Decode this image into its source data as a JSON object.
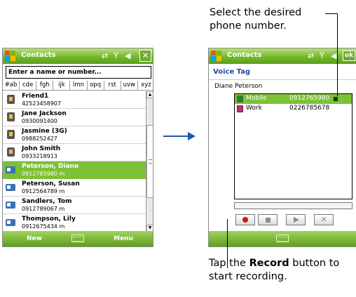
{
  "phone1": {
    "title": "Contacts",
    "status_icons": "⇄ Ÿ◀",
    "close_label": "✕",
    "search_placeholder": "Enter a name or number...",
    "alpha_tabs": [
      "#ab",
      "cde",
      "fgh",
      "ijk",
      "lmn",
      "opq",
      "rst",
      "uvw",
      "xyz"
    ],
    "contacts": [
      {
        "name": "Friend1",
        "number": "42523458907",
        "icon": "sim-card-icon",
        "selected": false
      },
      {
        "name": "Jane Jackson",
        "number": "0930091400",
        "icon": "sim-card-icon",
        "selected": false
      },
      {
        "name": "Jasmine (3G)",
        "number": "0988252427",
        "icon": "sim-card-icon",
        "selected": false
      },
      {
        "name": "John Smith",
        "number": "0933218913",
        "icon": "sim-card-icon",
        "selected": false
      },
      {
        "name": "Peterson, Diane",
        "number": "0912765980   m",
        "icon": "contact-card-icon",
        "selected": true
      },
      {
        "name": "Peterson, Susan",
        "number": "0912564789   m",
        "icon": "contact-card-icon",
        "selected": false
      },
      {
        "name": "Sandlers, Tom",
        "number": "0912789067   m",
        "icon": "contact-card-icon",
        "selected": false
      },
      {
        "name": "Thompson, Lily",
        "number": "0912675434   m",
        "icon": "contact-card-icon",
        "selected": false
      }
    ],
    "softkey_left": "New",
    "softkey_right": "Menu"
  },
  "phone2": {
    "title": "Contacts",
    "status_icons": "⇄ Ÿ◀",
    "ok_label": "ok",
    "header": "Voice Tag",
    "owner": "Diane Peterson",
    "numbers": [
      {
        "label": "Mobile",
        "number": "0912765980",
        "icon": "mobile-phone-icon",
        "selected": true
      },
      {
        "label": "Work",
        "number": "0226785678",
        "icon": "work-phone-icon",
        "selected": false
      }
    ],
    "buttons": [
      "record",
      "stop",
      "play",
      "delete"
    ],
    "delete_label": "✕"
  },
  "annotations": {
    "top_line1": "Select the desired",
    "top_line2": "phone number.",
    "bottom_pre": "Tap the ",
    "bottom_bold": "Record",
    "bottom_post": " button to",
    "bottom_line2": "start recording."
  },
  "colors": {
    "titlebar_green": "#73b82c",
    "selection_green": "#7cc136",
    "header_blue": "#1f4e9a",
    "arrow_blue": "#1f5aa8",
    "record_red": "#d21414"
  }
}
